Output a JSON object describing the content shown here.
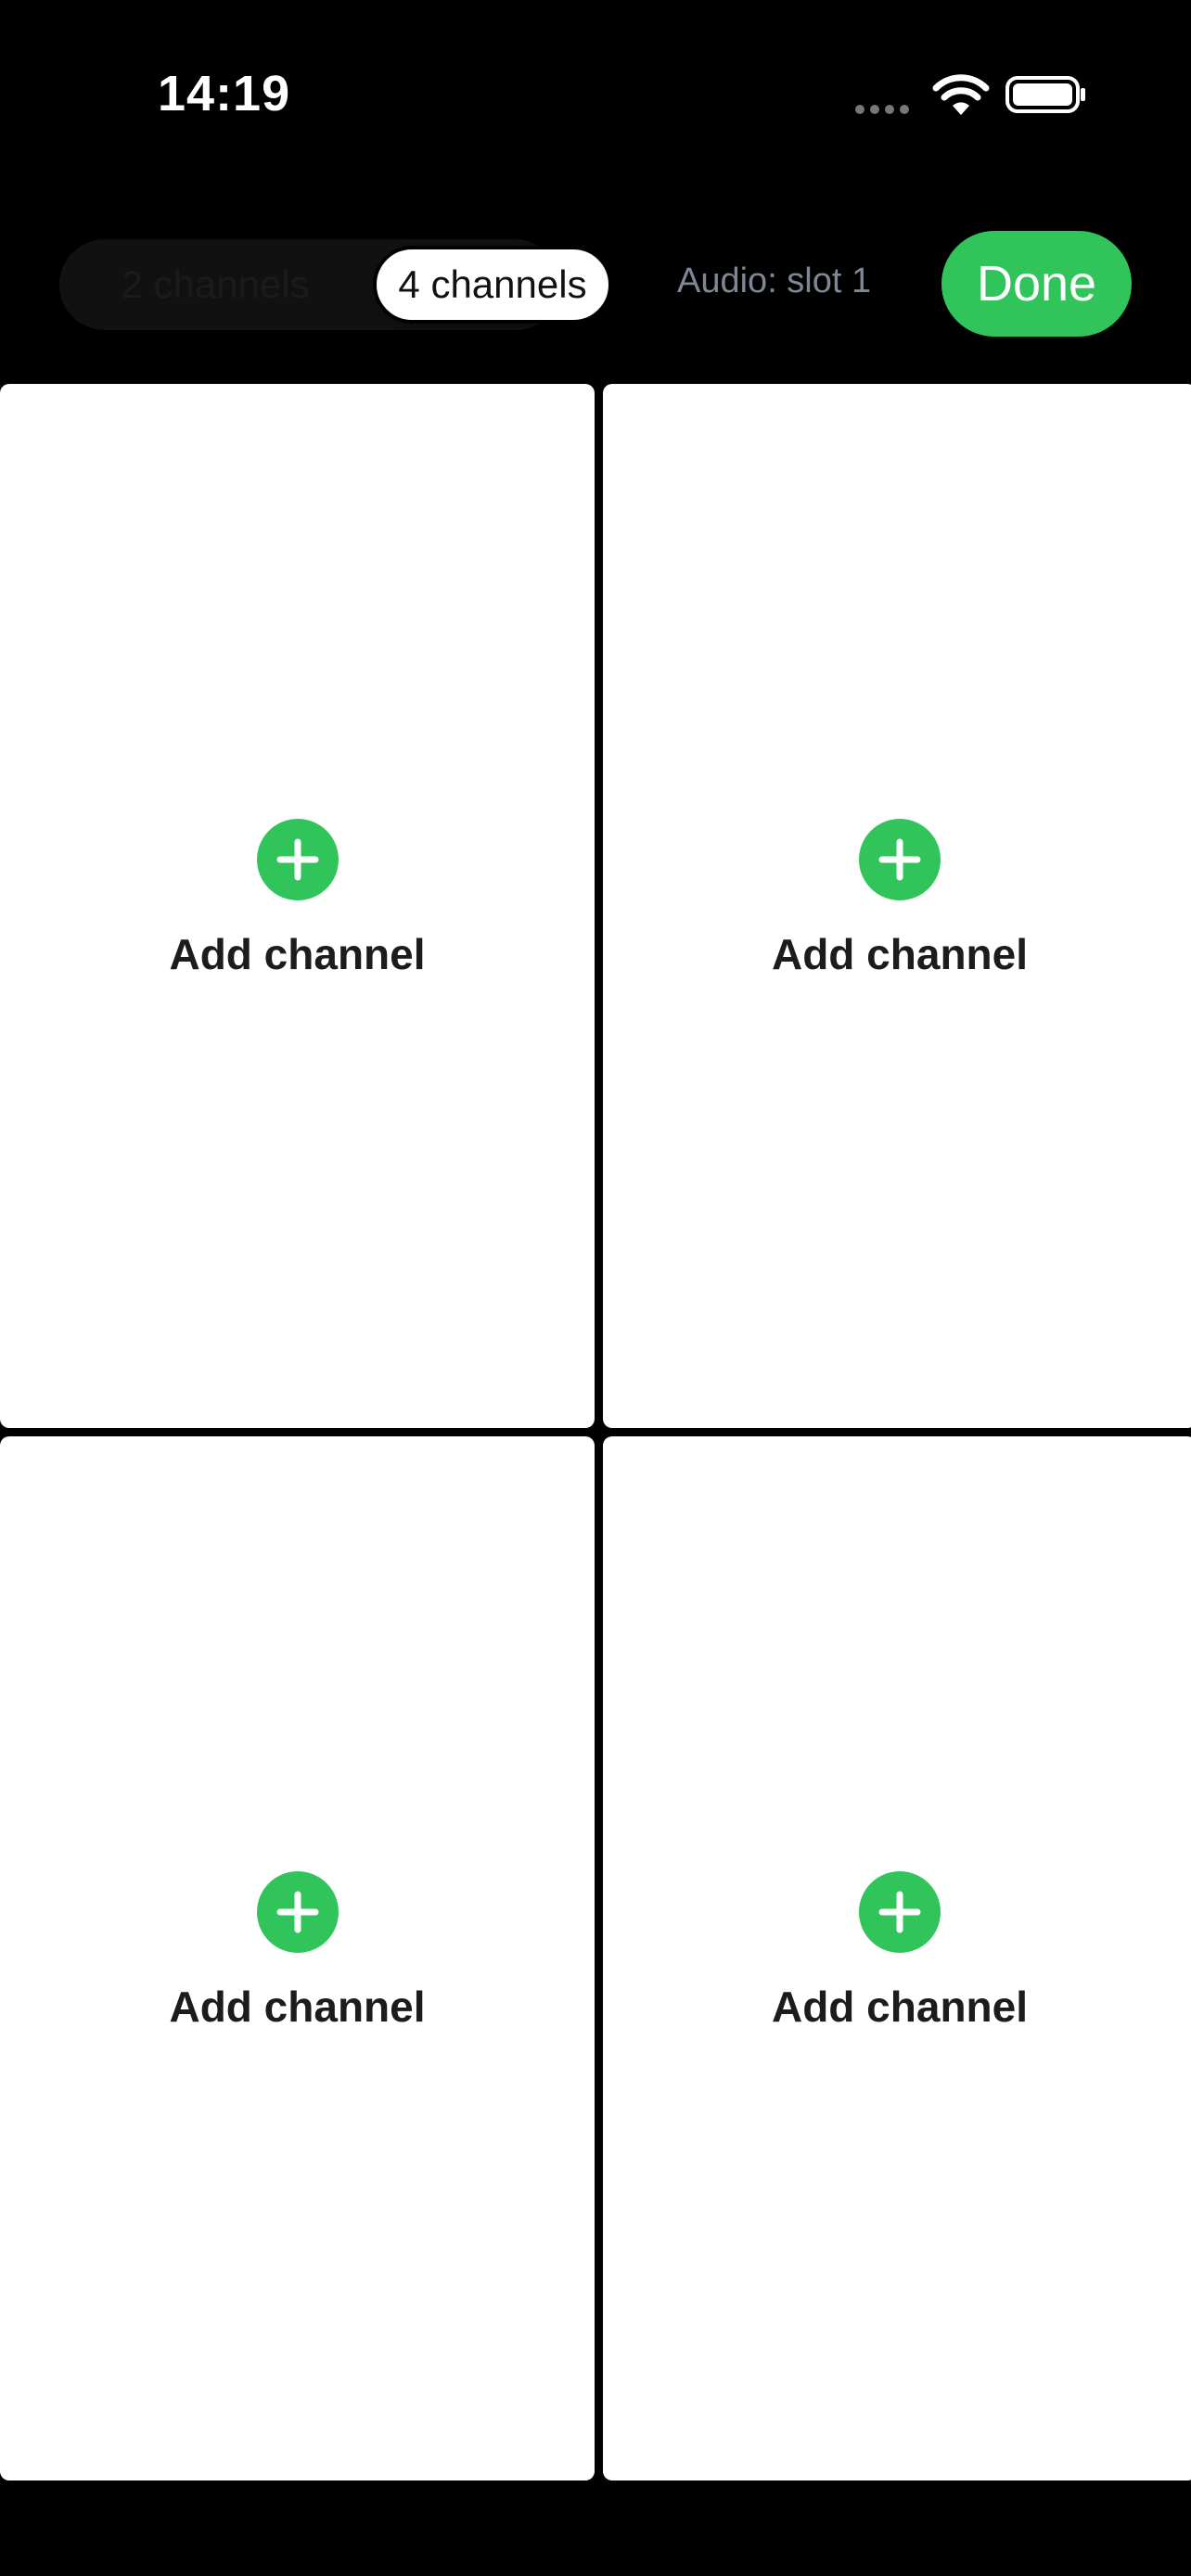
{
  "status_bar": {
    "time": "14:19",
    "icons": [
      "signal-dots-icon",
      "wifi-icon",
      "battery-icon"
    ]
  },
  "header": {
    "segments": [
      "2 channels",
      "4 channels"
    ],
    "selected_segment": "4 channels",
    "audio_label": "Audio: slot 1",
    "done_label": "Done"
  },
  "channels": [
    {
      "label": "Add channel",
      "icon": "plus-circle-icon"
    },
    {
      "label": "Add channel",
      "icon": "plus-circle-icon"
    },
    {
      "label": "Add channel",
      "icon": "plus-circle-icon"
    },
    {
      "label": "Add channel",
      "icon": "plus-circle-icon"
    }
  ],
  "colors": {
    "accent": "#31c45a",
    "background": "#000000",
    "panel": "#ffffff",
    "secondary_text": "#7f8794"
  }
}
